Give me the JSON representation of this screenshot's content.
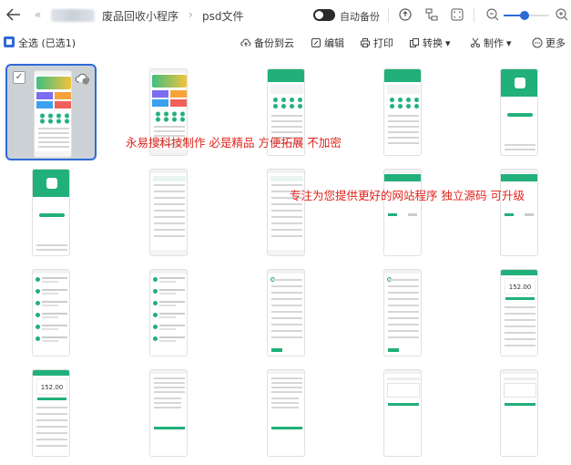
{
  "breadcrumb": {
    "prev": "«",
    "folder": "废品回收小程序",
    "sep": "›",
    "current": "psd文件"
  },
  "toolbar": {
    "auto_backup_label": "自动备份",
    "zoom_level": 0.45
  },
  "actions": {
    "select_all": "全选 (已选1)",
    "backup": "备份到云",
    "edit": "编辑",
    "print": "打印",
    "convert": "转换",
    "make": "制作",
    "more": "更多"
  },
  "watermarks": {
    "line1": "永易搜科技制作 必是精品 方便拓展 不加密",
    "line2": "专注为您提供更好的网站程序 独立源码 可升级"
  },
  "thumbnails": [
    {
      "variant": "home-banner",
      "selected": true
    },
    {
      "variant": "home-banner",
      "selected": false
    },
    {
      "variant": "home-green",
      "selected": false
    },
    {
      "variant": "home-green",
      "selected": false
    },
    {
      "variant": "login",
      "selected": false
    },
    {
      "variant": "login",
      "selected": false
    },
    {
      "variant": "form",
      "selected": false
    },
    {
      "variant": "form",
      "selected": false
    },
    {
      "variant": "tabs",
      "selected": false
    },
    {
      "variant": "tabs",
      "selected": false
    },
    {
      "variant": "list",
      "selected": false
    },
    {
      "variant": "list",
      "selected": false
    },
    {
      "variant": "detail",
      "selected": false
    },
    {
      "variant": "detail",
      "selected": false
    },
    {
      "variant": "wallet",
      "selected": false
    },
    {
      "variant": "wallet",
      "selected": false
    },
    {
      "variant": "text",
      "selected": false
    },
    {
      "variant": "text",
      "selected": false
    },
    {
      "variant": "settings",
      "selected": false
    },
    {
      "variant": "settings",
      "selected": false
    }
  ],
  "wallet_amount": "152.00",
  "colors": {
    "accent": "#2f6bd8",
    "brand_green": "#21b07a",
    "watermark": "#e0231c"
  }
}
